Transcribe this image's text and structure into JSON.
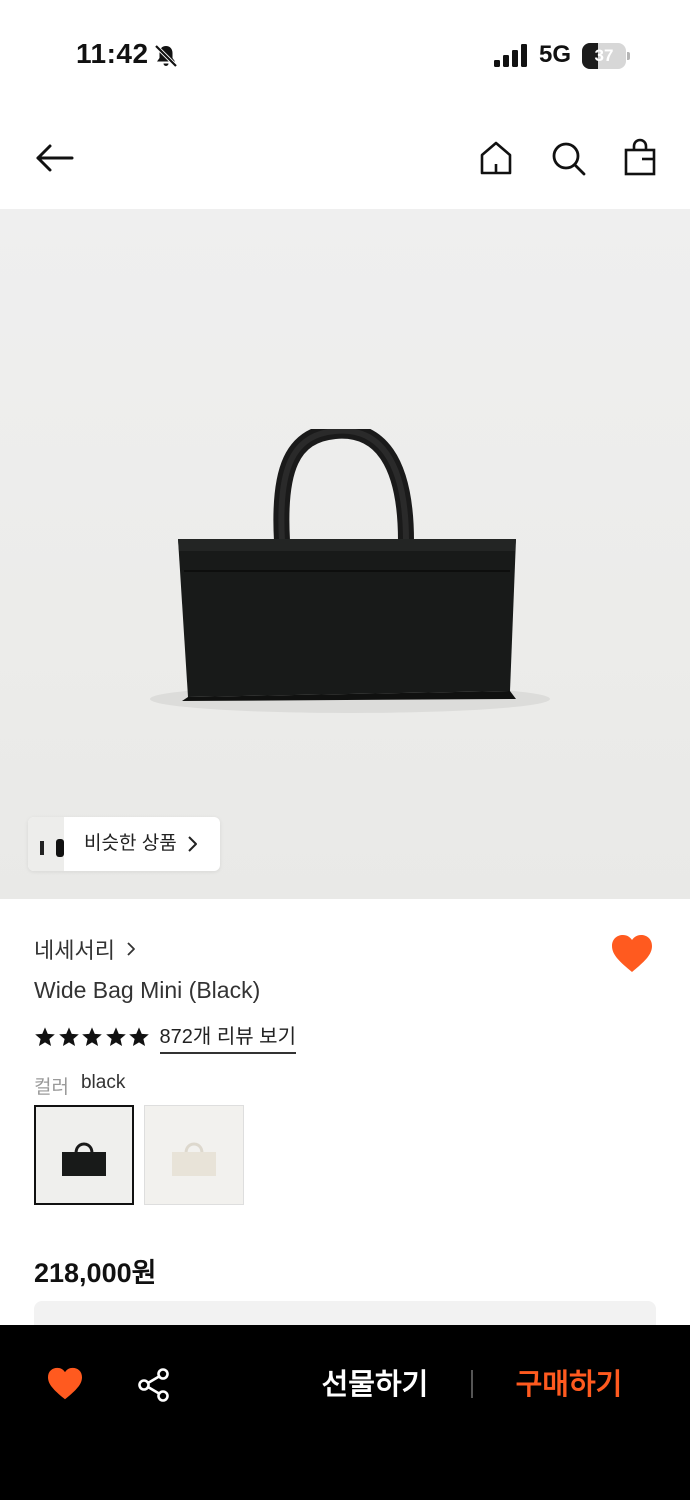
{
  "status_bar": {
    "time": "11:42",
    "network": "5G",
    "battery_level": "37",
    "icons": [
      "bell-muted-icon",
      "signal-icon",
      "battery-icon"
    ]
  },
  "nav": {
    "icons": [
      "back-arrow-icon",
      "home-icon",
      "search-icon",
      "shopping-bag-icon"
    ]
  },
  "hero": {
    "similar_label": "비슷한 상품"
  },
  "product": {
    "brand": "네세서리",
    "title": "Wide Bag Mini (Black)",
    "rating_stars": 5,
    "reviews_label": "872개 리뷰 보기",
    "color_label": "컬러",
    "color_value": "black",
    "swatches": [
      "black",
      "ivory"
    ],
    "price": "218,000원"
  },
  "bottom_bar": {
    "gift_label": "선물하기",
    "buy_label": "구매하기"
  },
  "colors": {
    "accent": "#ff5a1f",
    "bar_background": "#000000",
    "text_primary": "#111111",
    "text_muted": "#9a9a9a"
  }
}
